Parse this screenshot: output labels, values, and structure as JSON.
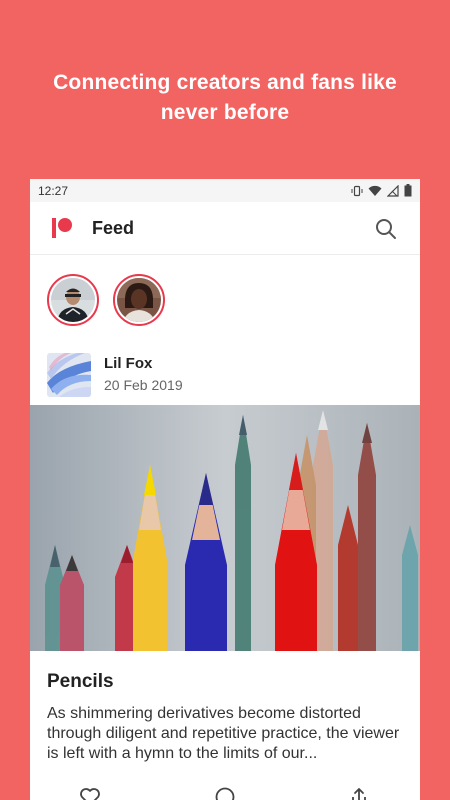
{
  "promo": {
    "line1": "Connecting creators and fans like",
    "line2": "never before"
  },
  "statusbar": {
    "time": "12:27",
    "icons": [
      "vibrate-icon",
      "wifi-icon",
      "signal-icon",
      "battery-icon"
    ]
  },
  "appbar": {
    "title": "Feed",
    "search_icon": "search-icon"
  },
  "stories": [
    {
      "name": "story-avatar-1"
    },
    {
      "name": "story-avatar-2"
    }
  ],
  "post": {
    "author": "Lil Fox",
    "date": "20 Feb 2019",
    "title": "Pencils",
    "body": "As shimmering derivatives become distorted through diligent and repetitive practice, the viewer is left with a hymn to the limits of our..."
  },
  "colors": {
    "background": "#f26462",
    "accent": "#e8394d"
  }
}
